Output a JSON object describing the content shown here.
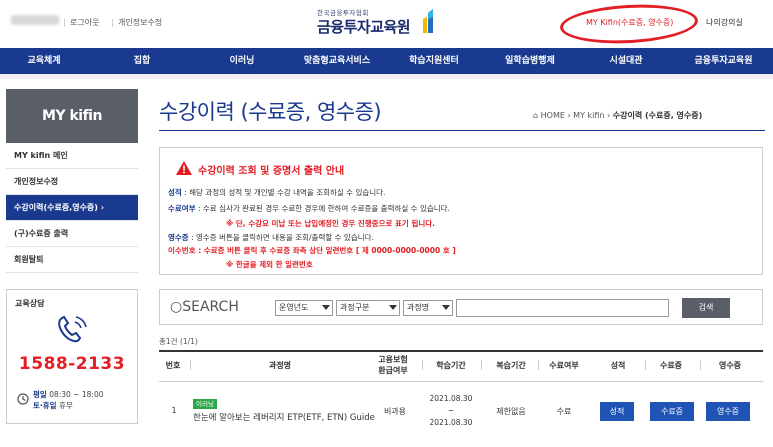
{
  "top": {
    "links": [
      "로그아웃",
      "개인정보수정"
    ],
    "logo_small": "한국금융투자협회",
    "logo_big": "금융투자교육원",
    "right_links": [
      "MY Kifin(수료증, 영수증)",
      "나의강의실"
    ]
  },
  "nav": [
    "교육체계",
    "집합",
    "이러닝",
    "맞춤형교육서비스",
    "학습지원센터",
    "일학습병행제",
    "시설대관",
    "금융투자교육원"
  ],
  "sidebar": {
    "title": "MY kifin",
    "items": [
      "MY kifin 메인",
      "개인정보수정",
      "수강이력(수료증,영수증) ›",
      "(구)수료증 출력",
      "회원탈퇴"
    ],
    "consult_title": "교육상담",
    "phone": "1588-2133",
    "hours_line1_bold": "평일",
    "hours_line1": "08:30 ~ 18:00",
    "hours_line2_bold": "토·휴일",
    "hours_line2": "휴무"
  },
  "main": {
    "title": "수강이력 (수료증, 영수증)",
    "breadcrumb_prefix": "HOME › MY kifin › ",
    "breadcrumb_current": "수강이력 (수료증, 영수증)",
    "notice": {
      "title": "수강이력 조회 및 증명서 출력 안내",
      "l1_key": "성적",
      "l1": " : 해당 과정의 성적 및 개인별 수강 내역을 조회하실 수 있습니다.",
      "l2_key": "수료여부",
      "l2": " : 수료 심사가 완료된 경우 수료한 경우에 한하여 수료증을 출력하실 수 있습니다.",
      "l3": "※ 단, 수강요 미납 또는 납입예정인 경우 진행중으로 표기 됩니다.",
      "l4_key": "영수증",
      "l4": " : 영수증 버튼을 클릭하면 내용을 조회/출력할 수 있습니다.",
      "l5_key": "이수번호",
      "l5": " : 수료증 버튼 클릭 후 수료증 좌측 상단 일련번호 [ 제 0000-0000-0000 호 ]",
      "l6": "※ 한글을 제외 한 일련번호"
    },
    "search": {
      "label": "SEARCH",
      "selects": [
        "운영년도",
        "과정구분",
        "과정명"
      ],
      "button": "검색"
    },
    "total": "총1건 (1/1)",
    "table": {
      "headers": [
        "번호",
        "과정명",
        "고용보험\n환급여부",
        "학습기간",
        "복습기간",
        "수료여부",
        "성적",
        "수료증",
        "영수증"
      ],
      "row": {
        "no": "1",
        "tag": "이러닝",
        "name": "한눈에 알아보는 레버리지 ETP(ETF, ETN) Guide",
        "refund": "비과용",
        "period_start": "2021.08.30",
        "period_mid": "~",
        "period_end": "2021.08.30",
        "review": "제한없음",
        "status": "수료",
        "btn_grade": "성적",
        "btn_cert": "수료증",
        "btn_receipt": "영수증"
      }
    }
  }
}
